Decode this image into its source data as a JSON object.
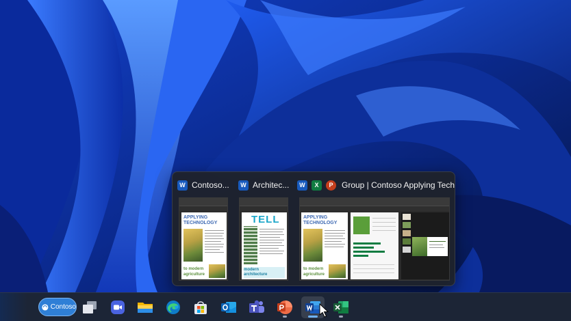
{
  "taskbar": {
    "contoso_label": "Contoso",
    "icons": [
      {
        "name": "task-view-icon"
      },
      {
        "name": "zoom-icon"
      },
      {
        "name": "file-explorer-icon"
      },
      {
        "name": "edge-icon"
      },
      {
        "name": "store-icon"
      },
      {
        "name": "outlook-icon"
      },
      {
        "name": "teams-icon"
      },
      {
        "name": "powerpoint-icon"
      },
      {
        "name": "word-icon"
      },
      {
        "name": "excel-icon"
      }
    ],
    "active_app": "word-icon"
  },
  "popup": {
    "thumbnails": [
      {
        "title": "Contoso...",
        "apps": [
          "word"
        ],
        "doc_title_1": "APPLYING",
        "doc_title_2": "TECHNOLOGY",
        "doc_footer_1": "to modern",
        "doc_footer_2": "agriculture"
      },
      {
        "title": "Architec...",
        "apps": [
          "word"
        ],
        "doc_heading": "TELL",
        "doc_footer_1": "modern",
        "doc_footer_2": "architecture"
      },
      {
        "title": "Group | Contoso Applying Tech",
        "apps": [
          "word",
          "excel",
          "powerpoint"
        ],
        "doc_title_1": "APPLYING",
        "doc_title_2": "TECHNOLOGY",
        "doc_footer_1": "to modern",
        "doc_footer_2": "agriculture"
      }
    ]
  },
  "app_letters": {
    "word": "W",
    "excel": "X",
    "powerpoint": "P"
  },
  "colors": {
    "word": "#185abd",
    "excel": "#107c41",
    "powerpoint": "#c43e1c",
    "taskbar": "#1c2536",
    "accent": "#2f7fd6"
  }
}
